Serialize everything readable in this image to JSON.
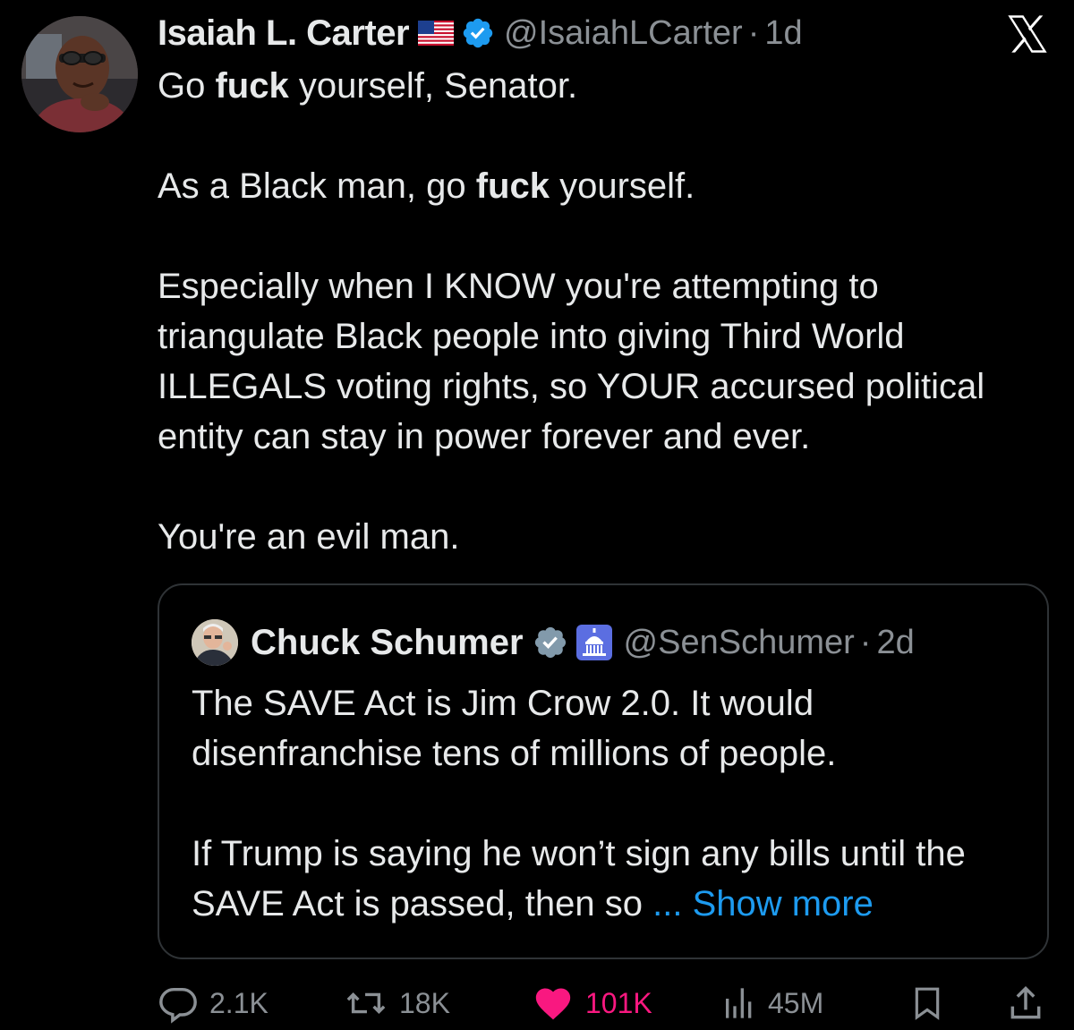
{
  "author": {
    "display_name": "Isaiah L. Carter",
    "handle": "@IsaiahLCarter",
    "separator": "·",
    "time": "1d",
    "flag_icon": "us-flag-icon",
    "verified_icon": "verified-badge-icon",
    "verified_color": "#1d9bf0"
  },
  "tweet": {
    "p1": {
      "a": "Go ",
      "bold": "fuck",
      "b": " yourself, Senator."
    },
    "p2": {
      "a": "As a Black man, go ",
      "bold": "fuck",
      "b": " yourself."
    },
    "p3": "Especially when I KNOW you're attempting to triangulate Black people into giving Third World ILLEGALS voting rights, so YOUR accursed political entity can stay in power forever and ever.",
    "p4": "You're an evil man."
  },
  "quote": {
    "display_name": "Chuck Schumer",
    "handle": "@SenSchumer",
    "separator": "·",
    "time": "2d",
    "verified_icon": "grey-verified-badge-icon",
    "affiliation_icon": "capitol-building-icon",
    "p1": "The SAVE Act is Jim Crow 2.0. It would disenfranchise tens of millions of people.",
    "p2": "If Trump is saying he won’t sign any bills until the SAVE Act is passed, then so ",
    "show_more": "... Show more",
    "show_more_color": "#1d9bf0"
  },
  "actions": {
    "replies": "2.1K",
    "reposts": "18K",
    "likes": "101K",
    "views": "45M",
    "like_color": "#f91880"
  },
  "brand": {
    "logo_icon": "x-logo-icon"
  }
}
